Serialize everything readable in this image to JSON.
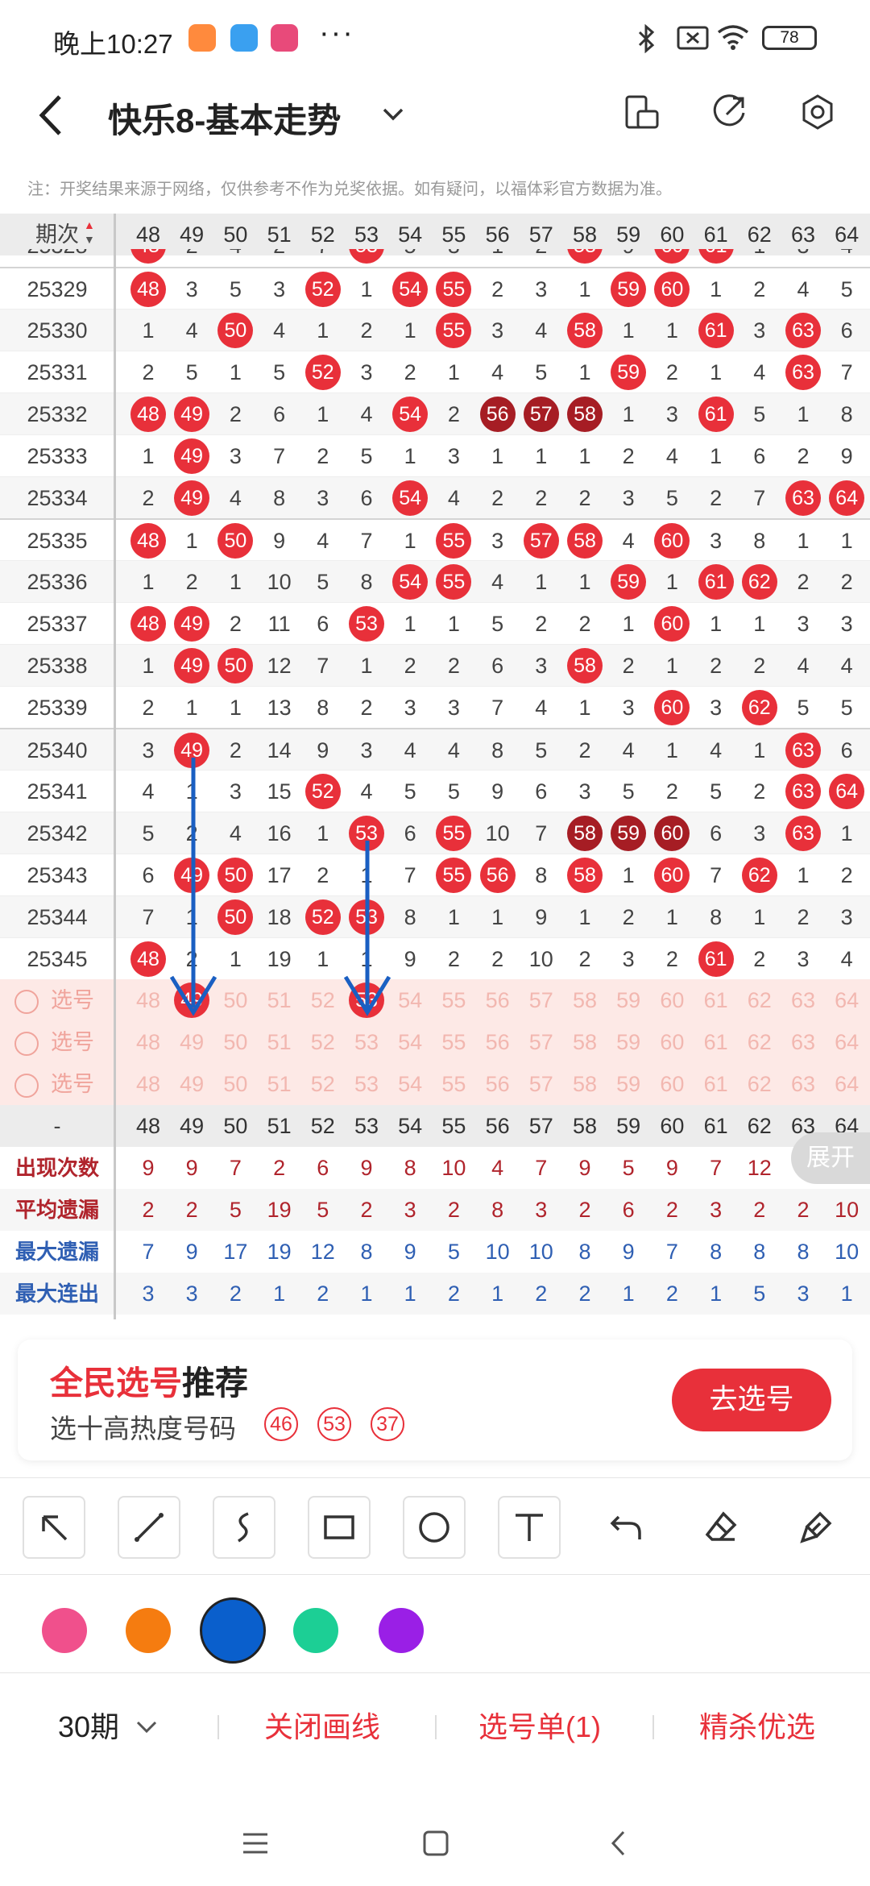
{
  "status": {
    "time": "晚上10:27",
    "more": "···",
    "battery": "78"
  },
  "title": {
    "text": "快乐8-基本走势"
  },
  "notice": "注：开奖结果来源于网络，仅供参考不作为兑奖依据。如有疑问，以福体彩官方数据为准。",
  "table": {
    "period_header": "期次",
    "columns": [
      "48",
      "49",
      "50",
      "51",
      "52",
      "53",
      "54",
      "55",
      "56",
      "57",
      "58",
      "59",
      "60",
      "61",
      "62",
      "63",
      "64"
    ],
    "partial_row": {
      "period": "25328",
      "cells": [
        "48",
        "2",
        "4",
        "2",
        "7",
        "53",
        "5",
        "3",
        "1",
        "2",
        "58",
        "9",
        "60",
        "61",
        "1",
        "3",
        "4"
      ]
    },
    "rows": [
      {
        "period": "25329",
        "cells": [
          "48",
          "3",
          "5",
          "3",
          "52",
          "1",
          "54",
          "55",
          "2",
          "3",
          "1",
          "59",
          "60",
          "1",
          "2",
          "4",
          "5"
        ]
      },
      {
        "period": "25330",
        "cells": [
          "1",
          "4",
          "50",
          "4",
          "1",
          "2",
          "1",
          "55",
          "3",
          "4",
          "58",
          "1",
          "1",
          "61",
          "3",
          "63",
          "6"
        ]
      },
      {
        "period": "25331",
        "cells": [
          "2",
          "5",
          "1",
          "5",
          "52",
          "3",
          "2",
          "1",
          "4",
          "5",
          "1",
          "59",
          "2",
          "1",
          "4",
          "63",
          "7"
        ]
      },
      {
        "period": "25332",
        "cells": [
          "48",
          "49",
          "2",
          "6",
          "1",
          "4",
          "54",
          "2",
          "56",
          "57",
          "58",
          "1",
          "3",
          "61",
          "5",
          "1",
          "8"
        ]
      },
      {
        "period": "25333",
        "cells": [
          "1",
          "49",
          "3",
          "7",
          "2",
          "5",
          "1",
          "3",
          "1",
          "1",
          "1",
          "2",
          "4",
          "1",
          "6",
          "2",
          "9"
        ]
      },
      {
        "period": "25334",
        "cells": [
          "2",
          "49",
          "4",
          "8",
          "3",
          "6",
          "54",
          "4",
          "2",
          "2",
          "2",
          "3",
          "5",
          "2",
          "7",
          "63",
          "64"
        ]
      },
      {
        "period": "25335",
        "cells": [
          "48",
          "1",
          "50",
          "9",
          "4",
          "7",
          "1",
          "55",
          "3",
          "57",
          "58",
          "4",
          "60",
          "3",
          "8",
          "1",
          "1"
        ]
      },
      {
        "period": "25336",
        "cells": [
          "1",
          "2",
          "1",
          "10",
          "5",
          "8",
          "54",
          "55",
          "4",
          "1",
          "1",
          "59",
          "1",
          "61",
          "62",
          "2",
          "2"
        ]
      },
      {
        "period": "25337",
        "cells": [
          "48",
          "49",
          "2",
          "11",
          "6",
          "53",
          "1",
          "1",
          "5",
          "2",
          "2",
          "1",
          "60",
          "1",
          "1",
          "3",
          "3"
        ]
      },
      {
        "period": "25338",
        "cells": [
          "1",
          "49",
          "50",
          "12",
          "7",
          "1",
          "2",
          "2",
          "6",
          "3",
          "58",
          "2",
          "1",
          "2",
          "2",
          "4",
          "4"
        ]
      },
      {
        "period": "25339",
        "cells": [
          "2",
          "1",
          "1",
          "13",
          "8",
          "2",
          "3",
          "3",
          "7",
          "4",
          "1",
          "3",
          "60",
          "3",
          "62",
          "5",
          "5"
        ]
      },
      {
        "period": "25340",
        "cells": [
          "3",
          "49",
          "2",
          "14",
          "9",
          "3",
          "4",
          "4",
          "8",
          "5",
          "2",
          "4",
          "1",
          "4",
          "1",
          "63",
          "6"
        ]
      },
      {
        "period": "25341",
        "cells": [
          "4",
          "1",
          "3",
          "15",
          "52",
          "4",
          "5",
          "5",
          "9",
          "6",
          "3",
          "5",
          "2",
          "5",
          "2",
          "63",
          "64"
        ]
      },
      {
        "period": "25342",
        "cells": [
          "5",
          "2",
          "4",
          "16",
          "1",
          "53",
          "6",
          "55",
          "10",
          "7",
          "58",
          "59",
          "60",
          "6",
          "3",
          "63",
          "1"
        ]
      },
      {
        "period": "25343",
        "cells": [
          "6",
          "49",
          "50",
          "17",
          "2",
          "1",
          "7",
          "55",
          "56",
          "8",
          "58",
          "1",
          "60",
          "7",
          "62",
          "1",
          "2"
        ]
      },
      {
        "period": "25344",
        "cells": [
          "7",
          "1",
          "50",
          "18",
          "52",
          "53",
          "8",
          "1",
          "1",
          "9",
          "1",
          "2",
          "1",
          "8",
          "1",
          "2",
          "3"
        ]
      },
      {
        "period": "25345",
        "cells": [
          "48",
          "2",
          "1",
          "19",
          "1",
          "1",
          "9",
          "2",
          "2",
          "10",
          "2",
          "3",
          "2",
          "61",
          "2",
          "3",
          "4"
        ]
      }
    ],
    "pick_label": "选号",
    "pick_rows": [
      {
        "selected": [
          "49",
          "53"
        ]
      },
      {
        "selected": []
      },
      {
        "selected": []
      }
    ],
    "footer_label": "-",
    "stats": [
      {
        "label": "出现次数",
        "values": [
          "9",
          "9",
          "7",
          "2",
          "6",
          "9",
          "8",
          "10",
          "4",
          "7",
          "9",
          "5",
          "9",
          "7",
          "12",
          "",
          ""
        ],
        "color": "#b0242c"
      },
      {
        "label": "平均遗漏",
        "values": [
          "2",
          "2",
          "5",
          "19",
          "5",
          "2",
          "3",
          "2",
          "8",
          "3",
          "2",
          "6",
          "2",
          "3",
          "2",
          "2",
          "10"
        ],
        "color": "#b0242c"
      },
      {
        "label": "最大遗漏",
        "values": [
          "7",
          "9",
          "17",
          "19",
          "12",
          "8",
          "9",
          "5",
          "10",
          "10",
          "8",
          "9",
          "7",
          "8",
          "8",
          "8",
          "10"
        ],
        "color": "#2f5fb3"
      },
      {
        "label": "最大连出",
        "values": [
          "3",
          "3",
          "2",
          "1",
          "2",
          "1",
          "1",
          "2",
          "1",
          "2",
          "2",
          "1",
          "2",
          "1",
          "5",
          "3",
          "1"
        ],
        "color": "#2f5fb3"
      }
    ],
    "expand": "展开"
  },
  "recommend": {
    "title_red": "全民选号",
    "title_black": "推荐",
    "subtitle": "选十高热度号码",
    "balls": [
      "46",
      "53",
      "37"
    ],
    "button": "去选号"
  },
  "tools": [
    "arrow-tool-icon",
    "line-tool-icon",
    "curve-tool-icon",
    "rectangle-tool-icon",
    "circle-tool-icon",
    "text-tool-icon",
    "undo-icon",
    "eraser-icon",
    "clear-icon"
  ],
  "colors": [
    "#f0508c",
    "#f57c10",
    "#0a5fcc",
    "#1ccf95",
    "#9a1fe6"
  ],
  "bottom": {
    "period": "30期",
    "close_lines": "关闭画线",
    "pick_list": "选号单(1)",
    "kill": "精杀优选"
  }
}
